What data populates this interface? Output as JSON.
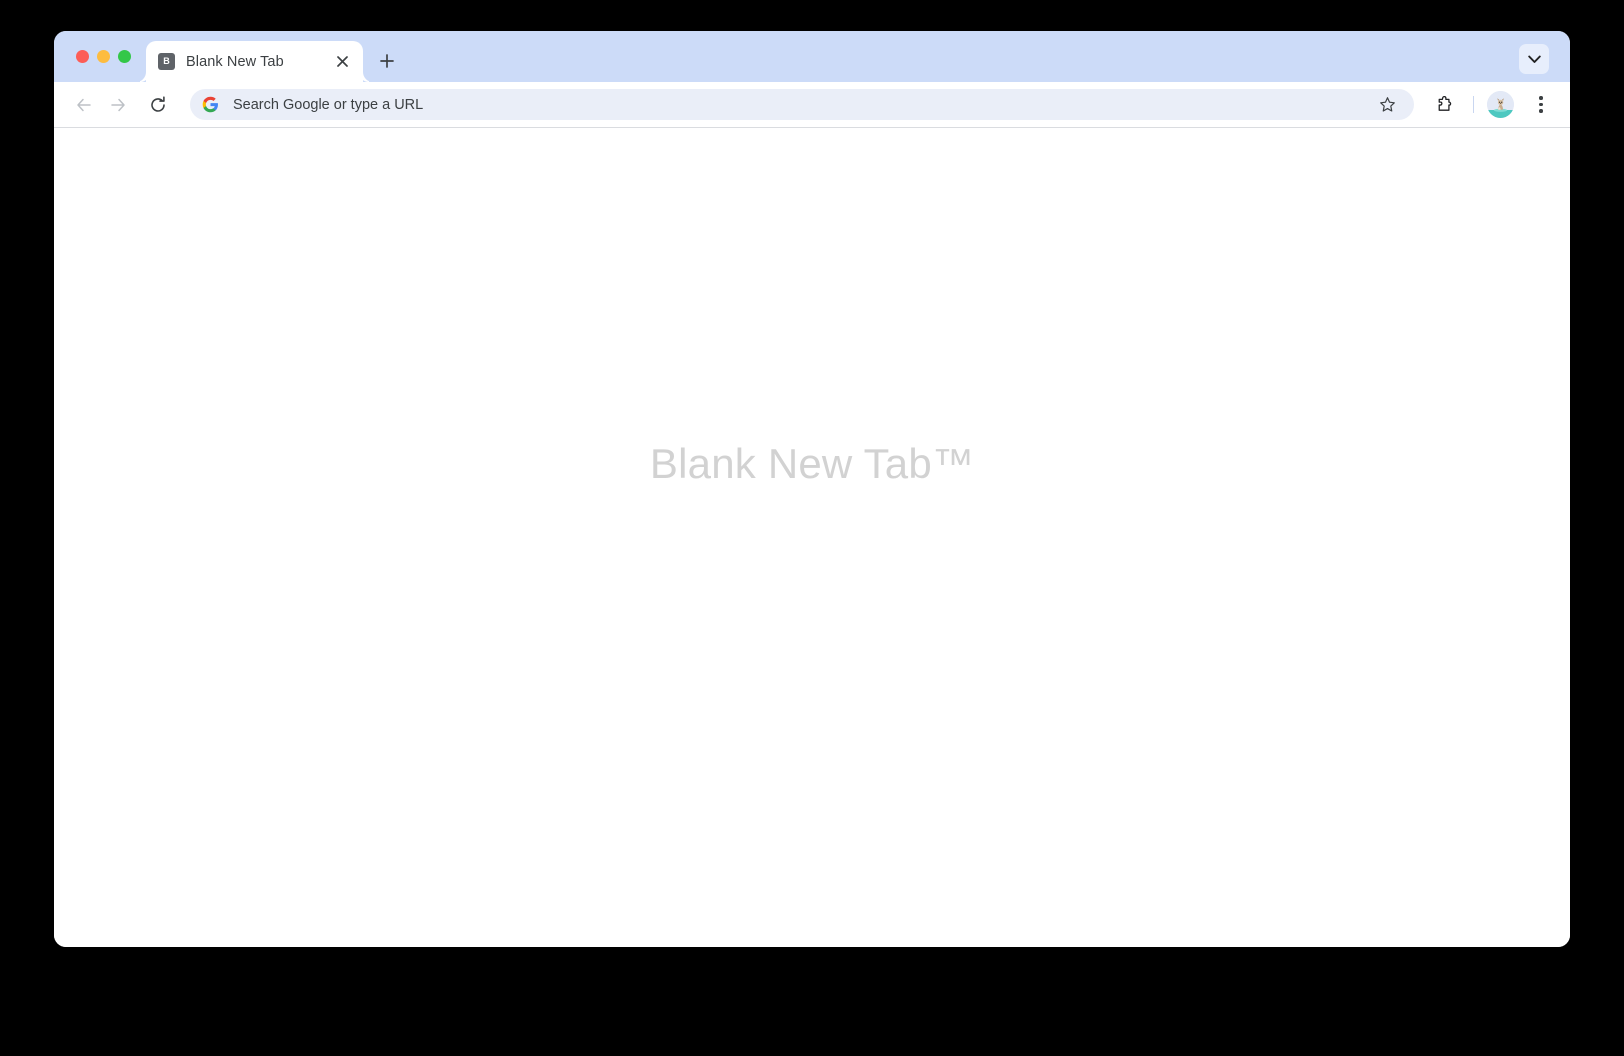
{
  "window": {
    "title": "Blank New Tab"
  },
  "traffic_lights": [
    {
      "name": "close",
      "color": "#fc5d57"
    },
    {
      "name": "minimize",
      "color": "#fdbc40"
    },
    {
      "name": "maximize",
      "color": "#33c748"
    }
  ],
  "tabstrip": {
    "background_color": "#ccdbf8",
    "tabs": [
      {
        "title": "Blank New Tab",
        "favicon_letter": "B",
        "favicon_color": "#5f6368",
        "active": true,
        "close_label": "×"
      }
    ],
    "new_tab_label": "+",
    "tab_search_label": "⌄"
  },
  "toolbar": {
    "back_label": "←",
    "forward_label": "→",
    "reload_label": "↻",
    "omnibox": {
      "value": "",
      "placeholder": "Search Google or type a URL",
      "display_text": "Search Google or type a URL",
      "background_color": "#eaeef8",
      "search_engine": "google"
    },
    "bookmark_label": "☆",
    "extensions_label": "extensions",
    "profile_label": "profile",
    "menu_label": "⋮"
  },
  "page": {
    "headline": "Blank New Tab™",
    "headline_color": "#d2d2d2",
    "background_color": "#ffffff"
  }
}
